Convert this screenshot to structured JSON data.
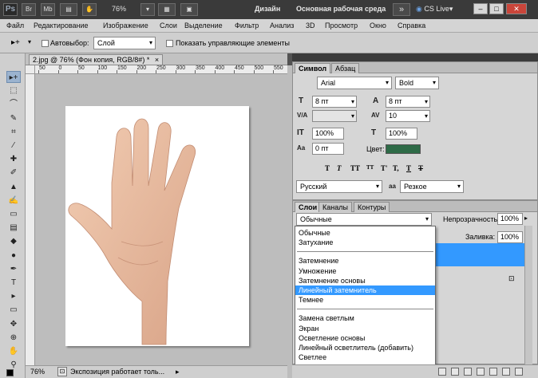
{
  "titlebar": {
    "logo": "Ps",
    "btn_br": "Br",
    "btn_mb": "Mb",
    "zoom": "76%",
    "workspace_design": "Дизайн",
    "workspace_main": "Основная рабочая среда",
    "overflow": "»",
    "cs_live": "CS Live",
    "cs_live_arrow": "▾",
    "win_min": "–",
    "win_max": "□",
    "win_close": "✕",
    "logo_color": "#9aa7b8"
  },
  "menu": {
    "items": [
      "Файл",
      "Редактирование",
      "Изображение",
      "Слои",
      "Выделение",
      "Фильтр",
      "Анализ",
      "3D",
      "Просмотр",
      "Окно",
      "Справка"
    ]
  },
  "options": {
    "tool_glyph": "▸+",
    "tool_arrow": "▾",
    "autoselect_label": "Автовыбор:",
    "autoselect_value": "Слой",
    "show_controls_label": "Показать управляющие элементы"
  },
  "tools": [
    {
      "name": "move-tool-icon",
      "glyph": "▸+"
    },
    {
      "name": "marquee-tool-icon",
      "glyph": "⬚"
    },
    {
      "name": "lasso-tool-icon",
      "glyph": "⌒"
    },
    {
      "name": "quick-select-tool-icon",
      "glyph": "✎"
    },
    {
      "name": "crop-tool-icon",
      "glyph": "⌗"
    },
    {
      "name": "eyedropper-tool-icon",
      "glyph": "⁄"
    },
    {
      "name": "healing-tool-icon",
      "glyph": "✚"
    },
    {
      "name": "brush-tool-icon",
      "glyph": "✐"
    },
    {
      "name": "stamp-tool-icon",
      "glyph": "▲"
    },
    {
      "name": "history-brush-icon",
      "glyph": "✍"
    },
    {
      "name": "eraser-tool-icon",
      "glyph": "▭"
    },
    {
      "name": "gradient-tool-icon",
      "glyph": "▤"
    },
    {
      "name": "blur-tool-icon",
      "glyph": "◆"
    },
    {
      "name": "dodge-tool-icon",
      "glyph": "●"
    },
    {
      "name": "pen-tool-icon",
      "glyph": "✒"
    },
    {
      "name": "type-tool-icon",
      "glyph": "T"
    },
    {
      "name": "path-select-tool-icon",
      "glyph": "▸"
    },
    {
      "name": "shape-tool-icon",
      "glyph": "▭"
    },
    {
      "name": "3d-rotate-tool-icon",
      "glyph": "✥"
    },
    {
      "name": "3d-camera-tool-icon",
      "glyph": "⊕"
    },
    {
      "name": "hand-tool-icon",
      "glyph": "✋"
    },
    {
      "name": "zoom-tool-icon",
      "glyph": "⚲"
    }
  ],
  "document": {
    "tab_title": "2.jpg @ 76% (Фон копия, RGB/8#) *",
    "tab_close": "×",
    "ruler_labels": [
      "50",
      "0",
      "50",
      "100",
      "150",
      "200",
      "250",
      "300",
      "350",
      "400",
      "450",
      "500",
      "550"
    ],
    "zoom": "76%",
    "status": "Экспозиция работает толь...",
    "status_arrow": "▸"
  },
  "symbol_panel": {
    "tabs": [
      "Символ",
      "Абзац"
    ],
    "font_family": "Arial",
    "font_style": "Bold",
    "size_icon": "T",
    "size": "8 пт",
    "leading_icon": "A",
    "leading": "8 пт",
    "kerning_icon": "V/A",
    "kerning": "",
    "tracking_icon": "AV",
    "tracking": "10",
    "vscale_icon": "IT",
    "vscale": "100%",
    "hscale_icon": "T",
    "hscale": "100%",
    "baseline_icon": "Aa",
    "baseline": "0 пт",
    "color_label": "Цвет:",
    "color": "#2e6b47",
    "styles": [
      "T",
      "T",
      "TT",
      "TT",
      "T'",
      "T,",
      "T",
      "T"
    ],
    "language": "Русский",
    "aa_icon": "aa",
    "antialias": "Резкое"
  },
  "layers_panel": {
    "tabs": [
      "Слои",
      "Каналы",
      "Контуры"
    ],
    "blend_mode": "Обычные",
    "opacity_label": "Непрозрачность:",
    "opacity": "100%",
    "fill_label": "Заливка:",
    "fill": "100%",
    "lock_icon": "🔒"
  },
  "blend_dropdown": {
    "groups": [
      [
        "Обычные",
        "Затухание"
      ],
      [
        "Затемнение",
        "Умножение",
        "Затемнение основы",
        "Линейный затемнитель",
        "Темнее"
      ],
      [
        "Замена светлым",
        "Экран",
        "Осветление основы",
        "Линейный осветлитель (добавить)",
        "Светлее"
      ],
      [
        "Перекрытие"
      ]
    ],
    "selected": "Линейный затемнитель"
  }
}
